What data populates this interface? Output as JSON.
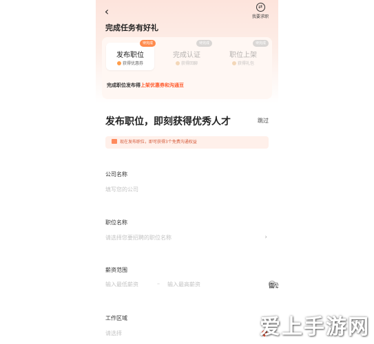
{
  "header": {
    "back_icon": "back-arrow-icon",
    "switch_label": "我要求职",
    "switch_icon": "switch-icon",
    "title": "完成任务有好礼"
  },
  "tasks": [
    {
      "name": "发布职位",
      "badge": "待完成",
      "sub": "获得优惠券",
      "state": "active"
    },
    {
      "name": "完成认证",
      "badge": "待完成",
      "sub": "获得回聊",
      "state": "inactive"
    },
    {
      "name": "职位上架",
      "badge": "待完成",
      "sub": "获得礼包",
      "state": "inactive"
    }
  ],
  "task_desc": {
    "prefix": "完成职位发布得",
    "highlight": "上架优惠券和沟通豆"
  },
  "main": {
    "headline": "发布职位，即刻获得优秀人才",
    "skip_label": "跳过",
    "notice": "现在发布职位，即可获得3个免费沟通权益"
  },
  "fields": {
    "company": {
      "label": "公司名称",
      "placeholder": "填写您的公司"
    },
    "position": {
      "label": "职位名称",
      "placeholder": "请选择您要招聘的职位名称"
    },
    "salary": {
      "label": "薪资范围",
      "min_placeholder": "输入最低薪资",
      "separator": "–",
      "max_placeholder": "输入最高薪资",
      "negotiable_label": "面议"
    },
    "area": {
      "label": "工作区域",
      "placeholder": "请选择"
    }
  },
  "watermark": "爱上手游网",
  "colors": {
    "accent": "#ff5a2c",
    "badge": "#ff8a4c",
    "notice_bg": "#fff0ea"
  }
}
